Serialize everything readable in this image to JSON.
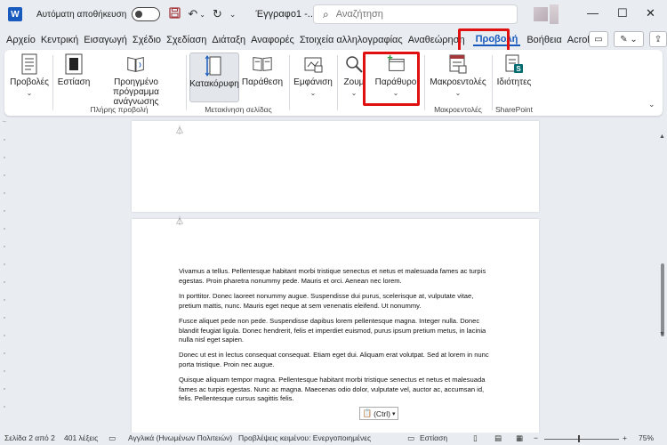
{
  "titlebar": {
    "app_logo": "W",
    "autosave_label": "Αυτόματη αποθήκευση",
    "doc_title": "Έγγραφο1  -...",
    "search_placeholder": "Αναζήτηση",
    "icons": [
      "save-icon",
      "undo-icon",
      "redo-icon",
      "chevron-down-icon"
    ],
    "window_controls": {
      "minimize": "—",
      "maximize": "☐",
      "close": "✕"
    }
  },
  "menu": {
    "items": [
      "Αρχείο",
      "Κεντρική",
      "Εισαγωγή",
      "Σχέδιο",
      "Σχεδίαση",
      "Διάταξη",
      "Αναφορές",
      "Στοιχεία αλληλογραφίας",
      "Αναθεώρηση",
      "Προβολή",
      "Βοήθεια",
      "Acrobat"
    ],
    "active_index": 9,
    "highlight_color": "#e01010"
  },
  "ribbon": {
    "buttons": {
      "views": "Προβολές",
      "focus": "Εστίαση",
      "immersive_reader": "Προηγμένο πρόγραμμα ανάγνωσης",
      "vertical": "Κατακόρυφη",
      "side_by_side": "Παράθεση",
      "show": "Εμφάνιση",
      "zoom": "Ζουμ",
      "window": "Παράθυρο",
      "macros": "Μακροεντολές",
      "properties": "Ιδιότητες"
    },
    "groups": {
      "immersive": "Πλήρης προβολή",
      "page_movement": "Μετακίνηση σελίδας",
      "macros": "Μακροεντολές",
      "sharepoint": "SharePoint"
    }
  },
  "document": {
    "paragraphs": [
      "Vivamus a tellus. Pellentesque habitant morbi tristique senectus et netus et malesuada fames ac turpis egestas. Proin pharetra nonummy pede. Mauris et orci. Aenean nec lorem.",
      "In porttitor. Donec laoreet nonummy augue. Suspendisse dui purus, scelerisque at, vulputate vitae, pretium mattis, nunc. Mauris eget neque at sem venenatis eleifend. Ut nonummy.",
      "Fusce aliquet pede non pede. Suspendisse dapibus lorem pellentesque magna. Integer nulla. Donec blandit feugiat ligula. Donec hendrerit, felis et imperdiet euismod, purus ipsum pretium metus, in lacinia nulla nisl eget sapien.",
      "Donec ut est in lectus consequat consequat. Etiam eget dui. Aliquam erat volutpat. Sed at lorem in nunc porta tristique. Proin nec augue.",
      "Quisque aliquam tempor magna. Pellentesque habitant morbi tristique senectus et netus et malesuada fames ac turpis egestas. Nunc ac magna. Maecenas odio dolor, vulputate vel, auctor ac, accumsan id, felis. Pellentesque cursus sagittis felis."
    ],
    "paste_label": "(Ctrl)"
  },
  "status": {
    "page": "Σελίδα 2 από 2",
    "words": "401 λέξεις",
    "language": "Αγγλικά (Ηνωμένων Πολιτειών)",
    "predictions": "Προβλέψεις κειμένου: Ενεργοποιημένες",
    "focus": "Εστίαση",
    "zoom": "75%"
  }
}
